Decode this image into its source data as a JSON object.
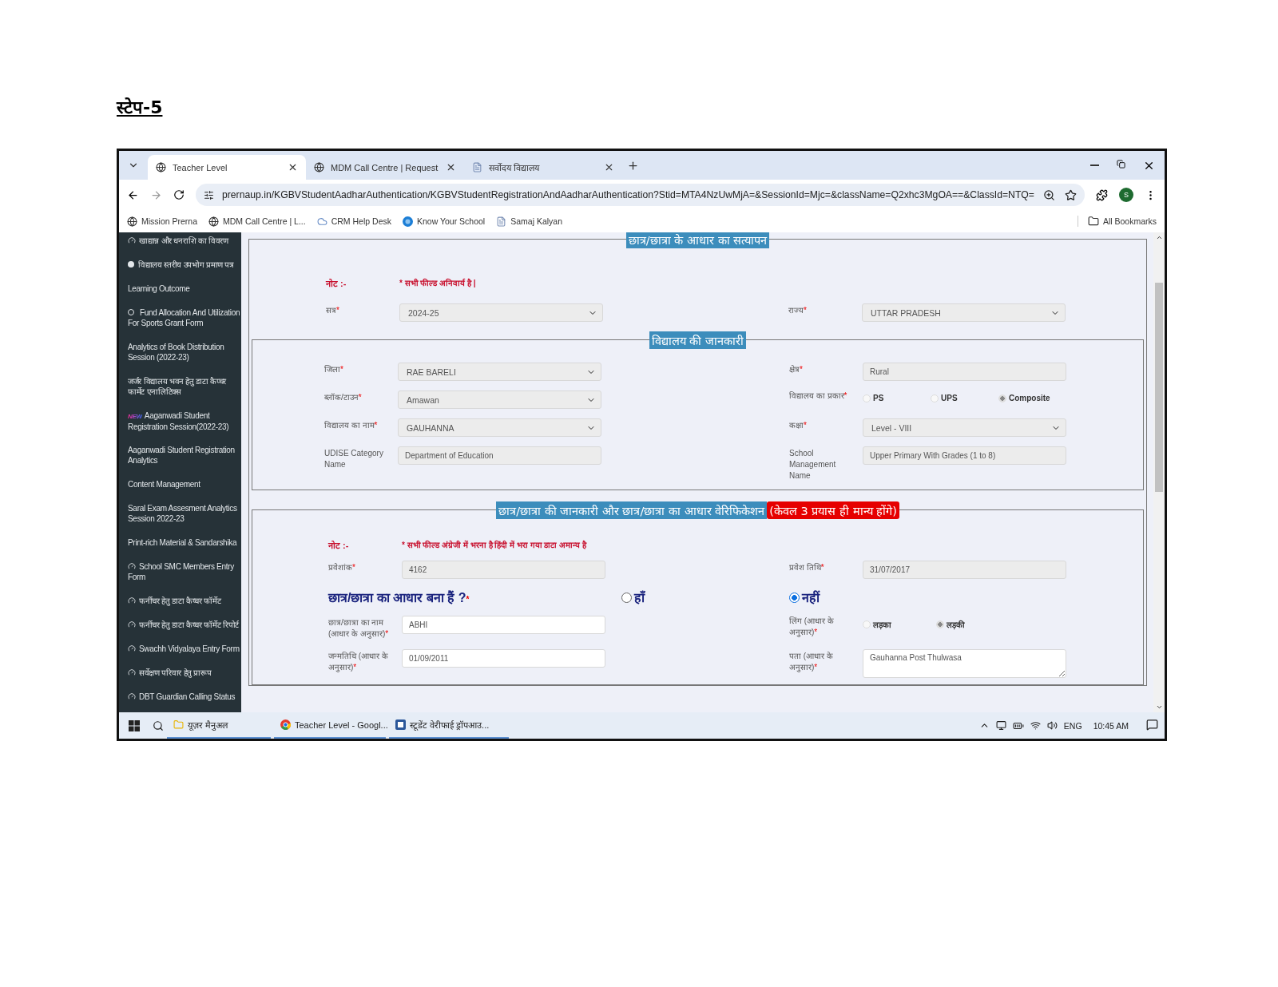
{
  "heading": "स्टेप-5",
  "browser": {
    "tabs": [
      {
        "title": "Teacher Level",
        "selected": true,
        "kind": "globe"
      },
      {
        "title": "MDM Call Centre | Request",
        "selected": false,
        "kind": "globe"
      },
      {
        "title": "सर्वोदय विद्यालय",
        "selected": false,
        "kind": "page"
      }
    ],
    "url": "prernaup.in/KGBVStudentAadharAuthentication/KGBVStudentRegistrationAndAadharAuthentication?Stid=MTA4NzUwMjA=&SessionId=Mjc=&className=Q2xhc3MgOA==&ClassId=NTQ=",
    "profile_initial": "S",
    "bookmarks": [
      {
        "label": "Mission Prerna",
        "kind": "globe"
      },
      {
        "label": "MDM Call Centre | L...",
        "kind": "globe"
      },
      {
        "label": "CRM Help Desk",
        "kind": "cloud"
      },
      {
        "label": "Know Your School",
        "kind": "badge"
      },
      {
        "label": "Samaj Kalyan",
        "kind": "page"
      }
    ],
    "all_bookmarks": "All Bookmarks"
  },
  "sidebar": {
    "items": [
      {
        "label": "खाद्यान्न और धनराशि का विवरण",
        "kind": "gauge"
      },
      {
        "label": "विद्यालय स्तरीय उपभोग प्रमाण पत्र",
        "kind": "dot"
      },
      {
        "label": "Learning Outcome",
        "kind": "plain"
      },
      {
        "label": "Fund Allocation And Utilization For Sports Grant Form",
        "kind": "ring"
      },
      {
        "label": "Analytics of Book Distribution Session (2022-23)",
        "kind": "plain"
      },
      {
        "label": "जर्जर विद्यालय भवन हेतु डाटा कैप्चर फार्मेट एनालिटिक्स",
        "kind": "plain"
      },
      {
        "label": "Aaganwadi Student Registration Session(2022-23)",
        "kind": "new",
        "badge": "NEW"
      },
      {
        "label": "Aaganwadi Student Registration Analytics",
        "kind": "plain"
      },
      {
        "label": "Content Management",
        "kind": "plain"
      },
      {
        "label": "Saral Exam Assesment Analytics Session 2022-23",
        "kind": "plain"
      },
      {
        "label": "Print-rich Material & Sandarshika",
        "kind": "plain"
      },
      {
        "label": "School SMC Members Entry Form",
        "kind": "gauge"
      },
      {
        "label": "फर्नीचर हेतु डाटा कैप्चर फॉर्मेट",
        "kind": "gauge"
      },
      {
        "label": "फर्नीचर हेतु डाटा कैप्चर फॉर्मेट रिपोर्ट",
        "kind": "gauge"
      },
      {
        "label": "Swachh Vidyalaya Entry Form",
        "kind": "gauge"
      },
      {
        "label": "सर्वेक्षण परिवार हेतु प्रारूप",
        "kind": "gauge"
      },
      {
        "label": "DBT Guardian Calling Status",
        "kind": "gauge"
      }
    ]
  },
  "form": {
    "legend": "छात्र/छात्रा के आधार का सत्यापन",
    "note": {
      "label": "नोट :-",
      "text": "*  सभी फील्ड अनिवार्य है |"
    },
    "rows": [
      [
        {
          "label": "सत्र",
          "required": "*",
          "kind": "select",
          "disabled": true,
          "value": "2024-25"
        },
        {
          "label": "राज्य",
          "required": "*",
          "kind": "select",
          "disabled": true,
          "value": "UTTAR PRADESH"
        }
      ]
    ],
    "school": {
      "legend": "विद्यालय की जानकारी",
      "rows": [
        [
          {
            "label": "जिला",
            "required": "*",
            "kind": "select",
            "disabled": true,
            "value": "RAE BARELI"
          },
          {
            "label": "क्षेत्र",
            "required": "*",
            "kind": "text",
            "disabled": true,
            "value": "Rural"
          }
        ],
        [
          {
            "label": "ब्लॉक/टाउन",
            "required": "*",
            "kind": "select",
            "disabled": true,
            "value": "Amawan"
          },
          {
            "label": "विद्यालय का प्रकार",
            "required": "*",
            "kind": "radio",
            "disabled": true,
            "options": [
              {
                "label": "PS",
                "selected": false
              },
              {
                "label": "UPS",
                "selected": false
              },
              {
                "label": "Composite",
                "selected": true
              }
            ]
          }
        ],
        [
          {
            "label": "विद्यालय का नाम",
            "required": "*",
            "kind": "select",
            "disabled": true,
            "value": "GAUHANNA"
          },
          {
            "label": "कक्षा",
            "required": "*",
            "kind": "select",
            "disabled": true,
            "value": "Level - VIII"
          }
        ],
        [
          {
            "label": "UDISE Category Name",
            "kind": "text",
            "disabled": true,
            "value": "Department of Education"
          },
          {
            "label": "School Management Name",
            "kind": "text",
            "disabled": true,
            "value": "Upper Primary With Grades (1 to 8)"
          }
        ]
      ]
    },
    "student": {
      "legend": "छात्र/छात्रा की जानकारी  और छात्र/छात्रा का आधार वेरिफिकेशन",
      "legend_warning": "(केवल 3 प्रयास ही मान्य होंगे)",
      "note": {
        "label": "नोट :-",
        "text": "*  सभी फील्ड अंग्रेजी में भरना है हिंदी में भरा गया डाटा अमान्य है"
      },
      "rows": [
        [
          {
            "label": "प्रवेशांक",
            "required": "*",
            "kind": "text",
            "disabled": true,
            "value": "4162"
          },
          {
            "label": "प्रवेश तिथि",
            "required": "*",
            "kind": "text",
            "disabled": true,
            "value": "31/07/2017"
          }
        ]
      ],
      "aadhaar_question": {
        "label": "छात्र/छात्रा का आधार बना हैं ?",
        "required": "*",
        "options": [
          {
            "label": "हाँ",
            "selected": false
          },
          {
            "label": "नहीं",
            "selected": true
          }
        ]
      },
      "rows2": [
        [
          {
            "label": "छात्र/छात्रा का नाम (आधार के अनुसार)",
            "required": "*",
            "kind": "text",
            "disabled": false,
            "value": "ABHI"
          },
          {
            "label": "लिंग (आधार के अनुसार)",
            "required": "*",
            "kind": "radio",
            "disabled": true,
            "options": [
              {
                "label": "लड़का",
                "selected": false
              },
              {
                "label": "लड़की",
                "selected": true
              }
            ]
          }
        ],
        [
          {
            "label": "जन्मतिथि (आधार के अनुसार)",
            "required": "*",
            "kind": "text",
            "disabled": false,
            "value": "01/09/2011"
          },
          {
            "label": "पता (आधार के अनुसार)",
            "required": "*",
            "kind": "textarea",
            "disabled": false,
            "value": "Gauhanna Post Thulwasa"
          }
        ]
      ]
    }
  },
  "taskbar": {
    "items": [
      {
        "label": "यूज़र मैनुअल",
        "kind": "folder"
      },
      {
        "label": "Teacher Level - Googl...",
        "kind": "chrome"
      },
      {
        "label": "स्टूडेंट वेरीफाई ड्रॉपआउ...",
        "kind": "word"
      }
    ],
    "language": "ENG",
    "time": "10:45 AM"
  }
}
